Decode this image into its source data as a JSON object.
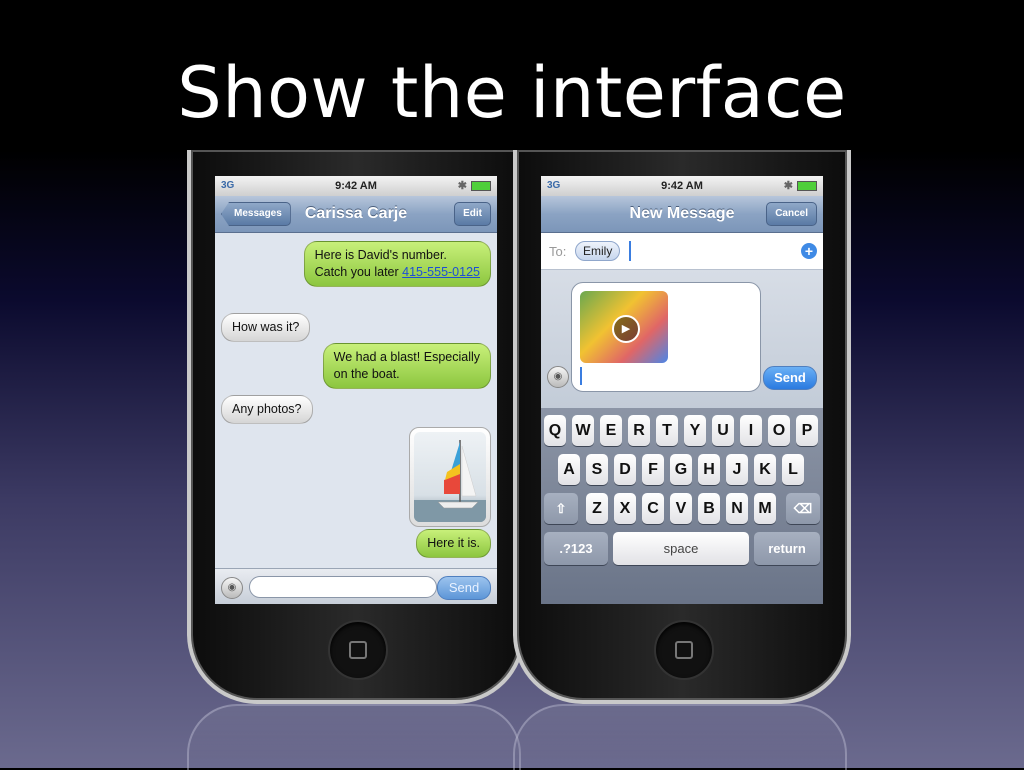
{
  "slide_title": "Show the interface",
  "left_phone": {
    "status": {
      "carrier": "3G",
      "time": "9:42 AM"
    },
    "nav": {
      "back_label": "Messages",
      "title": "Carissa Carje",
      "edit_label": "Edit"
    },
    "messages": [
      {
        "type": "sent",
        "text_line1": "Here is David's number.",
        "text_line2_prefix": "Catch you later ",
        "link": "415-555-0125"
      },
      {
        "type": "received",
        "text": "How was it?"
      },
      {
        "type": "sent",
        "text_line1": "We had a blast! Especially",
        "text_line2": "on the boat."
      },
      {
        "type": "received",
        "text": "Any photos?"
      },
      {
        "type": "sent",
        "text": "Here it is."
      }
    ],
    "composer": {
      "send_label": "Send"
    }
  },
  "right_phone": {
    "status": {
      "carrier": "3G",
      "time": "9:42 AM"
    },
    "nav": {
      "title": "New Message",
      "cancel_label": "Cancel"
    },
    "to": {
      "label": "To:",
      "recipient": "Emily"
    },
    "composer": {
      "send_label": "Send"
    },
    "keyboard": {
      "row1": [
        "Q",
        "W",
        "E",
        "R",
        "T",
        "Y",
        "U",
        "I",
        "O",
        "P"
      ],
      "row2": [
        "A",
        "S",
        "D",
        "F",
        "G",
        "H",
        "J",
        "K",
        "L"
      ],
      "row3": [
        "Z",
        "X",
        "C",
        "V",
        "B",
        "N",
        "M"
      ],
      "numbers_label": ".?123",
      "space_label": "space",
      "return_label": "return"
    }
  }
}
